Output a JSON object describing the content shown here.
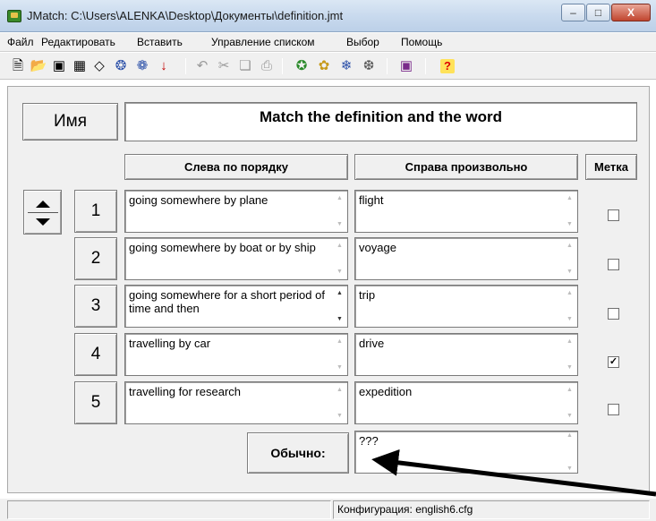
{
  "window": {
    "title": "JMatch: C:\\Users\\ALENKA\\Desktop\\Документы\\definition.jmt",
    "minimize": "–",
    "maximize": "□",
    "close": "X"
  },
  "menu": [
    "Файл",
    "Редактировать",
    "Вставить",
    "Управление списком",
    "Выбор",
    "Помощь"
  ],
  "toolbar": {
    "icons": [
      "new-icon",
      "open-icon",
      "save-icon",
      "save-as-icon",
      "clear-icon",
      "export-html-icon",
      "export-drag-icon",
      "export-down-icon",
      "undo-icon",
      "cut-icon",
      "copy-icon",
      "paste-icon",
      "config-icon",
      "config-load-icon",
      "config-save-icon",
      "config-options-icon",
      "exercise-icon",
      "help-icon"
    ]
  },
  "exercise": {
    "name_label": "Имя",
    "title": "Match the definition and the word"
  },
  "columns": {
    "left": "Слева по порядку",
    "right": "Справа произвольно",
    "fix": "Метка"
  },
  "rows": [
    {
      "num": "1",
      "left": "going somewhere by plane",
      "right": "flight",
      "fixed": false
    },
    {
      "num": "2",
      "left": "going somewhere by boat or by ship",
      "right": "voyage",
      "fixed": false
    },
    {
      "num": "3",
      "left": "going somewhere for a short period of time and then",
      "right": "trip",
      "fixed": false
    },
    {
      "num": "4",
      "left": "travelling by car",
      "right": "drive",
      "fixed": true
    },
    {
      "num": "5",
      "left": "travelling for research",
      "right": "expedition",
      "fixed": false
    }
  ],
  "default": {
    "label": "Обычно:",
    "value": "???"
  },
  "status": {
    "config": "Конфигурация: english6.cfg"
  },
  "colors": {
    "panel": "#f0f0f0",
    "annotation_arrow": "#000000"
  }
}
